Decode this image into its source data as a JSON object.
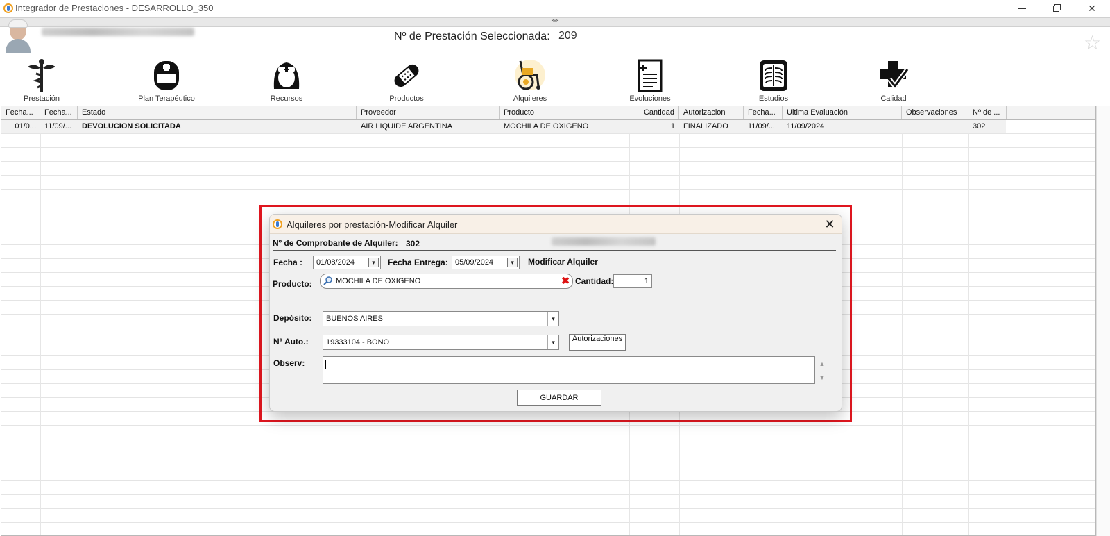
{
  "window": {
    "title": "Integrador de Prestaciones - DESARROLLO_350",
    "collapse_glyph": "︾",
    "min_glyph": "",
    "close_glyph": "✕"
  },
  "header": {
    "selected_label": "Nº de Prestación Seleccionada:",
    "selected_value": "209",
    "favorite_glyph": "☆"
  },
  "toolbar": [
    {
      "label": "Prestación",
      "icon": "caduceus-icon"
    },
    {
      "label": "Plan Terapéutico",
      "icon": "nurse-cap-icon"
    },
    {
      "label": "Recursos",
      "icon": "nurse-icon"
    },
    {
      "label": "Productos",
      "icon": "bandage-icon"
    },
    {
      "label": "Alquileres",
      "icon": "wheelchair-icon"
    },
    {
      "label": "Evoluciones",
      "icon": "document-icon"
    },
    {
      "label": "Estudios",
      "icon": "xray-icon"
    },
    {
      "label": "Calidad",
      "icon": "quality-cross-icon"
    }
  ],
  "grid": {
    "columns": [
      "Fecha...",
      "Fecha...",
      "Estado",
      "Proveedor",
      "Producto",
      "Cantidad",
      "Autorizacion",
      "Fecha...",
      "Ultima Evaluación",
      "Observaciones",
      "Nº de ..."
    ],
    "rows": [
      [
        "01/0...",
        "11/09/...",
        "DEVOLUCION SOLICITADA",
        "AIR LIQUIDE ARGENTINA",
        "MOCHILA DE OXIGENO",
        "1",
        "FINALIZADO",
        "11/09/...",
        "11/09/2024",
        "",
        "302"
      ]
    ]
  },
  "dialog": {
    "title": "Alquileres por prestación-Modificar Alquiler",
    "close_glyph": "✕",
    "comprobante_label": "Nº de Comprobante de Alquiler:",
    "comprobante_value": "302",
    "fecha_label": "Fecha :",
    "fecha_value": "01/08/2024",
    "fecha_entrega_label": "Fecha Entrega:",
    "fecha_entrega_value": "05/09/2024",
    "mode_label": "Modificar Alquiler",
    "producto_label": "Producto:",
    "producto_value": "MOCHILA DE OXIGENO",
    "clear_glyph": "✖",
    "cantidad_label": "Cantidad:",
    "cantidad_value": "1",
    "deposito_label": "Depósito:",
    "deposito_value": "BUENOS AIRES",
    "auto_label": "Nº Auto.:",
    "auto_value": "19333104 - BONO",
    "autorizaciones_button": "Autorizaciones",
    "observ_label": "Observ:",
    "observ_value": "",
    "save_button": "GUARDAR",
    "dropdown_glyph": "▾",
    "scroll_up_glyph": "▲",
    "scroll_down_glyph": "▼"
  }
}
